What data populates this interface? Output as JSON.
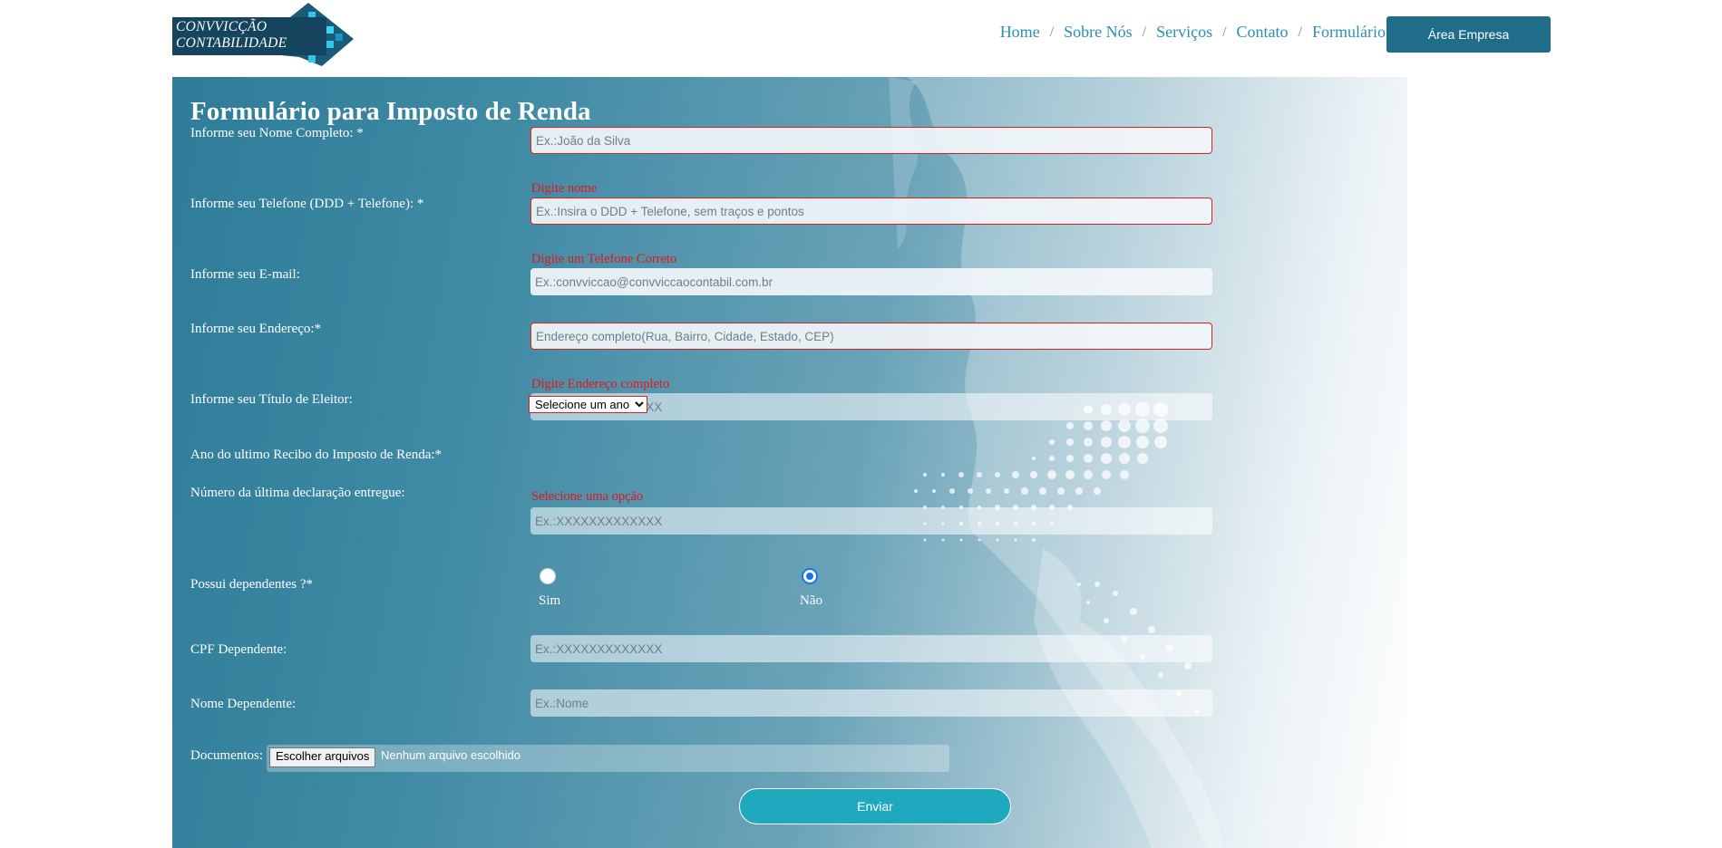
{
  "header": {
    "logo_line1": "CONVVICÇÃO",
    "logo_line2": "CONTABILIDADE",
    "nav": [
      "Home",
      "Sobre Nós",
      "Serviços",
      "Contato",
      "Formulário"
    ],
    "separator": "/",
    "area_button": "Área Empresa"
  },
  "form": {
    "title": "Formulário para Imposto de Renda",
    "nome": {
      "label": "Informe seu Nome Completo: *",
      "placeholder": "Ex.:João da Silva",
      "error": "Digite nome"
    },
    "telefone": {
      "label": "Informe seu Telefone (DDD + Telefone): *",
      "placeholder": "Ex.:Insira o DDD + Telefone, sem traços e pontos",
      "error": "Digite um Telefone Correto"
    },
    "email": {
      "label": "Informe seu E-mail:",
      "placeholder": "Ex.:convviccao@convviccaocontabil.com.br"
    },
    "endereco": {
      "label": "Informe seu Endereço:*",
      "placeholder": "Endereço completo(Rua, Bairro, Cidade, Estado, CEP)",
      "error": "Digite Endereço completo"
    },
    "titulo": {
      "label": "Informe seu Título de Eleitor:",
      "placeholder": "Ex.:XXXXXXXXXXXXX"
    },
    "ano": {
      "label": "Ano do ultimo Recibo do Imposto de Renda:*",
      "selected": "Selecione um ano",
      "error": "Selecione uma opção"
    },
    "declaracao": {
      "label": "Número da última declaração entregue:",
      "placeholder": "Ex.:XXXXXXXXXXXXX"
    },
    "dependentes": {
      "label": "Possui dependentes ?*",
      "option_yes": "Sim",
      "option_no": "Não",
      "selected": "Não"
    },
    "cpf_dependente": {
      "label": "CPF Dependente:",
      "placeholder": "Ex.:XXXXXXXXXXXXX"
    },
    "nome_dependente": {
      "label": "Nome Dependente:",
      "placeholder": "Ex.:Nome"
    },
    "documentos": {
      "label": "Documentos:",
      "button": "Escolher arquivos",
      "status": "Nenhum arquivo escolhido"
    },
    "submit": "Enviar"
  },
  "colors": {
    "accent": "#1f6d89",
    "nav": "#2b8fb3",
    "error": "#e8141a",
    "submit": "#1fa9bf"
  }
}
